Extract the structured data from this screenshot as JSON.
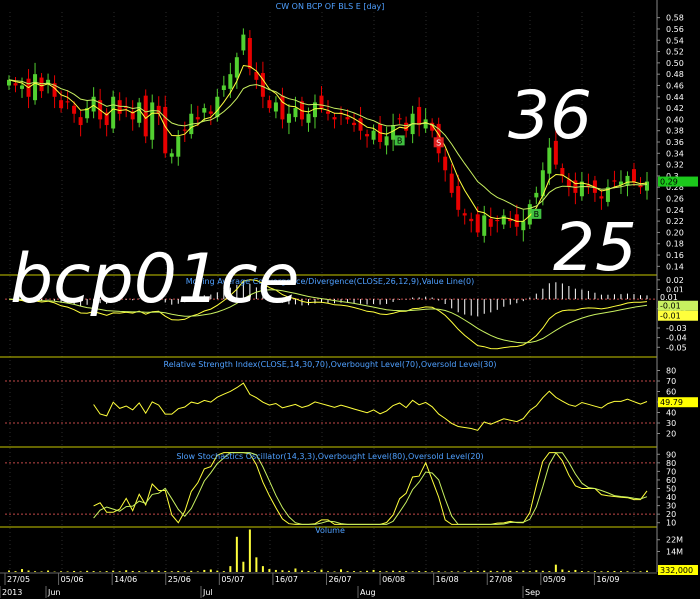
{
  "chart_data": [
    {
      "type": "candlestick",
      "title": "CW ON BCP OF BLS   E [day]",
      "ylim": [
        0.13,
        0.59
      ],
      "y_ticks": [
        "0.58",
        "0.56",
        "0.54",
        "0.52",
        "0.50",
        "0.48",
        "0.46",
        "0.44",
        "0.42",
        "0.40",
        "0.38",
        "0.36",
        "0.34",
        "0.32",
        "0.3",
        "0.28",
        "0.26",
        "0.24",
        "0.22",
        "0.20",
        "0.18",
        "0.16",
        "0.14"
      ],
      "last_value": "0.29",
      "close": [
        0.47,
        0.46,
        0.46,
        0.44,
        0.48,
        0.45,
        0.47,
        0.44,
        0.42,
        0.43,
        0.41,
        0.39,
        0.42,
        0.44,
        0.4,
        0.39,
        0.44,
        0.41,
        0.42,
        0.4,
        0.43,
        0.37,
        0.43,
        0.41,
        0.34,
        0.34,
        0.37,
        0.38,
        0.41,
        0.4,
        0.42,
        0.41,
        0.44,
        0.46,
        0.48,
        0.51,
        0.55,
        0.49,
        0.47,
        0.44,
        0.42,
        0.43,
        0.4,
        0.41,
        0.42,
        0.4,
        0.41,
        0.43,
        0.42,
        0.41,
        0.4,
        0.41,
        0.4,
        0.39,
        0.38,
        0.37,
        0.38,
        0.36,
        0.37,
        0.39,
        0.4,
        0.38,
        0.41,
        0.39,
        0.4,
        0.38,
        0.34,
        0.31,
        0.27,
        0.24,
        0.23,
        0.22,
        0.2,
        0.23,
        0.21,
        0.22,
        0.23,
        0.22,
        0.21,
        0.22,
        0.25,
        0.27,
        0.31,
        0.35,
        0.32,
        0.3,
        0.28,
        0.27,
        0.29,
        0.28,
        0.27,
        0.26,
        0.28,
        0.29,
        0.29,
        0.3,
        0.29,
        0.28,
        0.29
      ],
      "signals": [
        {
          "label": "B",
          "x_index": 60
        },
        {
          "label": "S",
          "x_index": 66
        },
        {
          "label": "B",
          "x_index": 81
        }
      ],
      "annotations": [
        "36",
        "25",
        "bcp01ce"
      ]
    },
    {
      "type": "line",
      "title": "Moving Average Convergence/Divergence(CLOSE,26,12,9),Value Line(0)",
      "ylim": [
        -0.058,
        0.025
      ],
      "y_ticks": [
        "0.02",
        "0.01",
        "-0.01",
        "-0.03",
        "-0.04",
        "-0.05"
      ],
      "value_labels": [
        "0.01",
        "-0.01",
        "-0.01"
      ]
    },
    {
      "type": "line",
      "title": "Relative Strength Index(CLOSE,14,30,70),Overbought Level(70),Oversold Level(30)",
      "ylim": [
        10,
        90
      ],
      "y_ticks": [
        "80",
        "70",
        "60",
        "50",
        "40",
        "30",
        "20"
      ],
      "levels": [
        70,
        30
      ],
      "last_value": "49.79"
    },
    {
      "type": "line",
      "title": "Slow Stochastics Oscillator(14,3,3),Overbought Level(80),Oversold Level(20)",
      "ylim": [
        5,
        95
      ],
      "y_ticks": [
        "90",
        "80",
        "70",
        "60",
        "50",
        "40",
        "30",
        "20",
        "10"
      ],
      "levels": [
        80,
        20
      ]
    },
    {
      "type": "bar",
      "title": "Volume",
      "y_ticks": [
        "22M",
        "14M"
      ],
      "last_value": "332,000",
      "values_m": [
        1.0,
        0.6,
        2.0,
        1.0,
        0.5,
        0.4,
        1.0,
        0.3,
        0.5,
        0.4,
        0.7,
        0.4,
        0.8,
        0.6,
        0.4,
        0.6,
        0.9,
        0.5,
        1.2,
        0.7,
        0.6,
        0.5,
        1.1,
        0.8,
        0.6,
        0.5,
        0.7,
        0.5,
        0.8,
        0.4,
        1.4,
        1.7,
        0.9,
        0.6,
        4.0,
        24.0,
        7.0,
        29.0,
        10.0,
        4.0,
        2.0,
        1.4,
        1.2,
        0.8,
        2.4,
        1.0,
        0.7,
        0.6,
        1.6,
        0.5,
        0.4,
        1.8,
        0.6,
        0.6,
        0.5,
        0.8,
        1.4,
        0.6,
        0.5,
        0.9,
        0.7,
        0.6,
        0.5,
        0.7,
        0.6,
        0.4,
        0.6,
        0.3,
        0.5,
        0.4,
        0.6,
        0.8,
        0.7,
        0.9,
        0.8,
        0.6,
        1.0,
        0.8,
        0.6,
        0.9,
        0.6,
        1.2,
        0.8,
        0.6,
        5.0,
        1.7,
        0.8,
        1.4,
        0.7,
        0.5,
        0.6,
        0.5,
        0.6,
        0.7,
        0.6,
        0.5,
        0.4,
        0.5,
        0.9
      ]
    }
  ],
  "x_axis": {
    "dates": [
      "27/05",
      "05/06",
      "14/06",
      "25/06",
      "05/07",
      "16/07",
      "26/07",
      "06/08",
      "16/08",
      "27/08",
      "05/09",
      "16/09"
    ],
    "months": [
      "2013",
      "Jun",
      "Jul",
      "Aug",
      "Sep"
    ]
  },
  "colors": {
    "up": "#52d030",
    "down": "#e80000",
    "ma_fast": "#ffff3c",
    "ma_slow": "#c8f060",
    "level": "#c04848",
    "panel_border": "#c8c800",
    "title_text": "#4fa0ff",
    "axis_text": "#ffffff"
  }
}
